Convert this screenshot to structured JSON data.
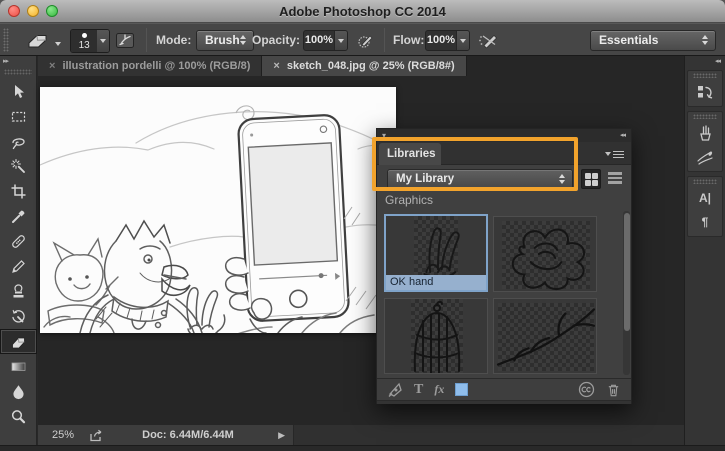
{
  "window": {
    "title": "Adobe Photoshop CC 2014"
  },
  "options_bar": {
    "brush_size": "13",
    "mode": {
      "label": "Mode:",
      "value": "Brush"
    },
    "opacity": {
      "label": "Opacity:",
      "value": "100%"
    },
    "flow": {
      "label": "Flow:",
      "value": "100%"
    },
    "workspace": {
      "value": "Essentials"
    }
  },
  "document_tabs": [
    {
      "label": "illustration pordelli @ 100% (RGB/8)",
      "active": false
    },
    {
      "label": "sketch_048.jpg @ 25% (RGB/8#)",
      "active": true
    }
  ],
  "toolbar": {
    "tools": [
      "move",
      "rectangular-marquee",
      "lasso",
      "magic-wand",
      "crop",
      "eyedropper",
      "spot-healing-brush",
      "brush",
      "clone-stamp",
      "history-brush",
      "eraser",
      "gradient",
      "blur",
      "dodge"
    ],
    "selected_tool": "eraser"
  },
  "libraries_panel": {
    "tab_label": "Libraries",
    "library_name": "My Library",
    "section_label": "Graphics",
    "items": [
      {
        "label": "OK hand",
        "selected": true
      },
      {
        "label": "",
        "selected": false
      },
      {
        "label": "",
        "selected": false
      },
      {
        "label": "",
        "selected": false
      }
    ],
    "footer": {
      "text_icon": "T",
      "fx_icon": "fx"
    }
  },
  "right_dock": {
    "character_icon": "A|",
    "paragraph_icon": "¶"
  },
  "status_bar": {
    "zoom_level": "25%",
    "doc_info": "Doc: 6.44M/6.44M",
    "expand_glyph": "▶"
  },
  "icons_glyphs": {
    "tab_close": "×",
    "collapse_right": "▸▸",
    "collapse_left": "◂◂",
    "panel_chevron": "▾"
  },
  "colors": {
    "annotation_orange": "#F2A32C",
    "selection_blue": "#96B0CE",
    "swatch_blue": "#8FBDEB"
  }
}
